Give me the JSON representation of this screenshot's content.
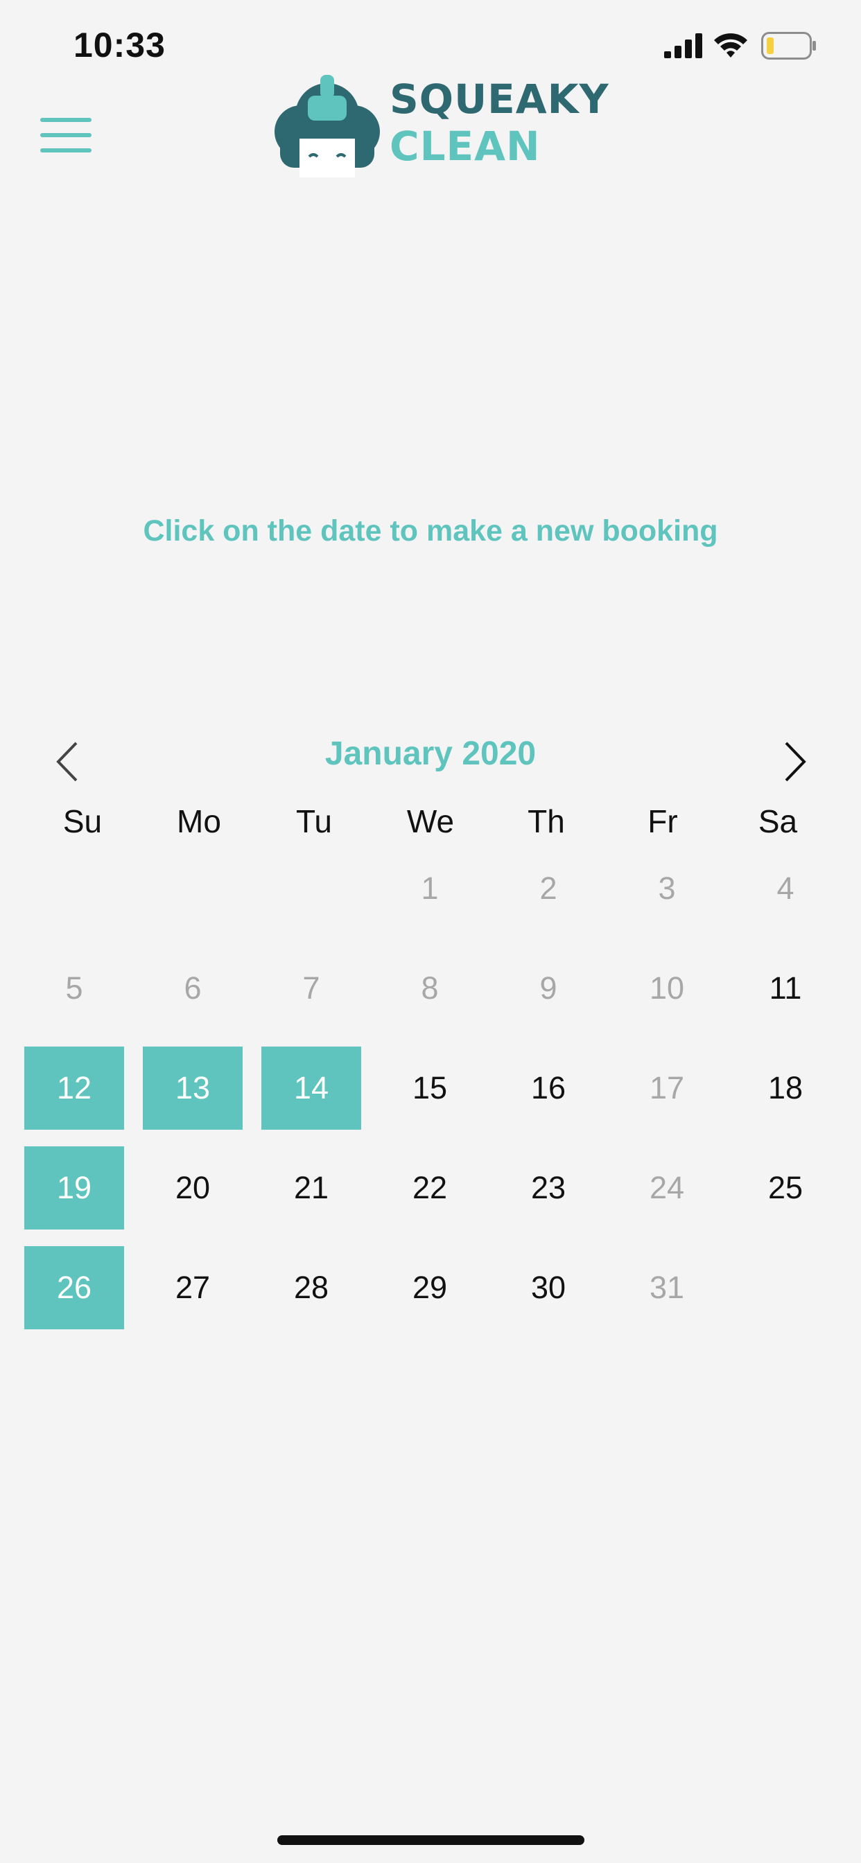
{
  "status_bar": {
    "time": "10:33",
    "battery_color": "#f5d142"
  },
  "header": {
    "logo_line1": "SQUEAKY",
    "logo_line2": "CLEAN",
    "menu_icon": "hamburger-icon"
  },
  "instruction": "Click on the date to make a new booking",
  "calendar": {
    "month_label": "January 2020",
    "weekdays": [
      "Su",
      "Mo",
      "Tu",
      "We",
      "Th",
      "Fr",
      "Sa"
    ],
    "days": [
      {
        "label": "1",
        "state": "disabled"
      },
      {
        "label": "2",
        "state": "disabled"
      },
      {
        "label": "3",
        "state": "disabled"
      },
      {
        "label": "4",
        "state": "disabled"
      },
      {
        "label": "5",
        "state": "disabled"
      },
      {
        "label": "6",
        "state": "disabled"
      },
      {
        "label": "7",
        "state": "disabled"
      },
      {
        "label": "8",
        "state": "disabled"
      },
      {
        "label": "9",
        "state": "disabled"
      },
      {
        "label": "10",
        "state": "disabled"
      },
      {
        "label": "11",
        "state": "available"
      },
      {
        "label": "12",
        "state": "selected"
      },
      {
        "label": "13",
        "state": "selected"
      },
      {
        "label": "14",
        "state": "selected"
      },
      {
        "label": "15",
        "state": "available"
      },
      {
        "label": "16",
        "state": "available"
      },
      {
        "label": "17",
        "state": "disabled"
      },
      {
        "label": "18",
        "state": "available"
      },
      {
        "label": "19",
        "state": "selected"
      },
      {
        "label": "20",
        "state": "available"
      },
      {
        "label": "21",
        "state": "available"
      },
      {
        "label": "22",
        "state": "available"
      },
      {
        "label": "23",
        "state": "available"
      },
      {
        "label": "24",
        "state": "disabled"
      },
      {
        "label": "25",
        "state": "available"
      },
      {
        "label": "26",
        "state": "selected"
      },
      {
        "label": "27",
        "state": "available"
      },
      {
        "label": "28",
        "state": "available"
      },
      {
        "label": "29",
        "state": "available"
      },
      {
        "label": "30",
        "state": "available"
      },
      {
        "label": "31",
        "state": "disabled"
      }
    ]
  },
  "colors": {
    "accent": "#5ec4bd",
    "brand_dark": "#2e6871",
    "text": "#111111",
    "disabled": "#a7a7a7",
    "background": "#f4f4f4"
  }
}
